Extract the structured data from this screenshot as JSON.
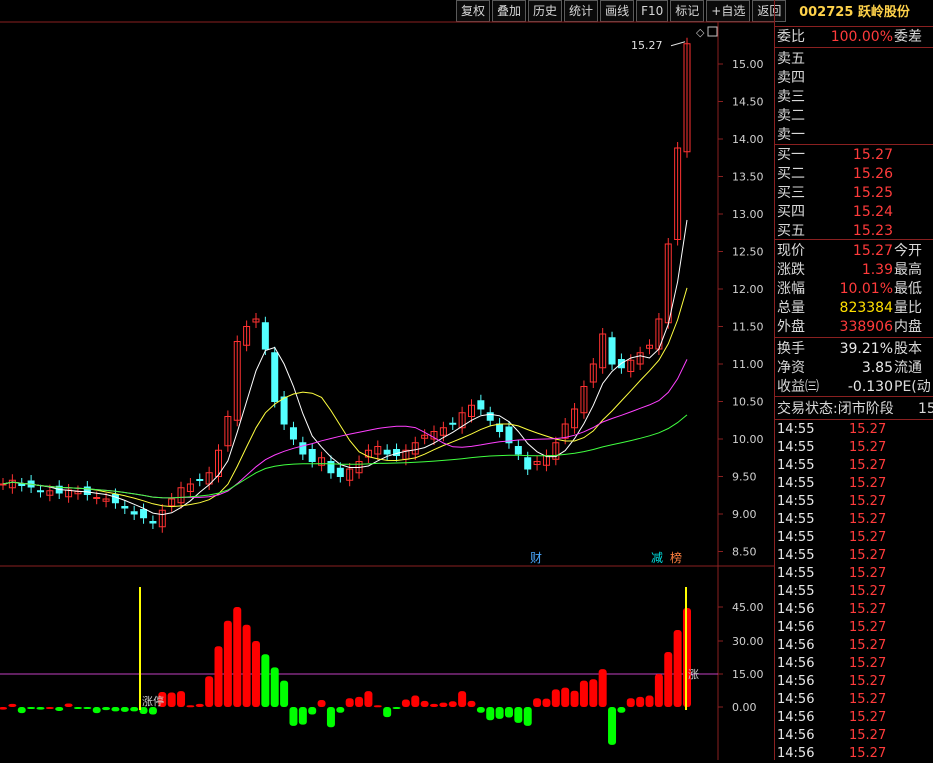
{
  "toolbar": {
    "buttons": [
      "复权",
      "叠加",
      "历史",
      "统计",
      "画线",
      "F10",
      "标记",
      "+自选",
      "返回"
    ]
  },
  "stock": {
    "code_name": "002725 跃岭股份"
  },
  "orderbook": {
    "ratio_label": "委比",
    "ratio_value": "100.00%",
    "diff_label": "委差",
    "asks": [
      {
        "label": "卖五",
        "price": ""
      },
      {
        "label": "卖四",
        "price": ""
      },
      {
        "label": "卖三",
        "price": ""
      },
      {
        "label": "卖二",
        "price": ""
      },
      {
        "label": "卖一",
        "price": ""
      }
    ],
    "bids": [
      {
        "label": "买一",
        "price": "15.27"
      },
      {
        "label": "买二",
        "price": "15.26"
      },
      {
        "label": "买三",
        "price": "15.25"
      },
      {
        "label": "买四",
        "price": "15.24"
      },
      {
        "label": "买五",
        "price": "15.23"
      }
    ]
  },
  "quote": [
    {
      "label": "现价",
      "value": "15.27",
      "sub": "今开"
    },
    {
      "label": "涨跌",
      "value": "1.39",
      "sub": "最高"
    },
    {
      "label": "涨幅",
      "value": "10.01%",
      "sub": "最低"
    },
    {
      "label": "总量",
      "value": "823384",
      "sub": "量比"
    },
    {
      "label": "外盘",
      "value": "338906",
      "sub": "内盘"
    }
  ],
  "fundamentals": [
    {
      "label": "换手",
      "value": "39.21%",
      "sub": "股本"
    },
    {
      "label": "净资",
      "value": "3.85",
      "sub": "流通"
    },
    {
      "label": "收益㈢",
      "value": "-0.130",
      "sub": "PE(动"
    }
  ],
  "trade_status": {
    "label": "交易状态:",
    "value": "闭市阶段",
    "extra": "15"
  },
  "ticks": [
    {
      "time": "14:55",
      "price": "15.27"
    },
    {
      "time": "14:55",
      "price": "15.27"
    },
    {
      "time": "14:55",
      "price": "15.27"
    },
    {
      "time": "14:55",
      "price": "15.27"
    },
    {
      "time": "14:55",
      "price": "15.27"
    },
    {
      "time": "14:55",
      "price": "15.27"
    },
    {
      "time": "14:55",
      "price": "15.27"
    },
    {
      "time": "14:55",
      "price": "15.27"
    },
    {
      "time": "14:55",
      "price": "15.27"
    },
    {
      "time": "14:55",
      "price": "15.27"
    },
    {
      "time": "14:56",
      "price": "15.27"
    },
    {
      "time": "14:56",
      "price": "15.27"
    },
    {
      "time": "14:56",
      "price": "15.27"
    },
    {
      "time": "14:56",
      "price": "15.27"
    },
    {
      "time": "14:56",
      "price": "15.27"
    },
    {
      "time": "14:56",
      "price": "15.27"
    },
    {
      "time": "14:56",
      "price": "15.27"
    },
    {
      "time": "14:56",
      "price": "15.27"
    },
    {
      "time": "14:56",
      "price": "15.27"
    }
  ],
  "price_axis": [
    "15.00",
    "14.50",
    "14.00",
    "13.50",
    "13.00",
    "12.50",
    "12.00",
    "11.50",
    "11.00",
    "10.50",
    "10.00",
    "9.50",
    "9.00",
    "8.50"
  ],
  "indicator_axis": [
    "45.00",
    "30.00",
    "15.00",
    "0.00"
  ],
  "annotations": {
    "high_label": "15.27",
    "cai": "财",
    "jian": "减",
    "bang": "榜",
    "zhangting": "涨停",
    "zhang": "涨"
  },
  "colors": {
    "up": "#ff3232",
    "down": "#54ffff",
    "ma5": "#ffffff",
    "ma10": "#ffff40",
    "ma20": "#ff40ff",
    "ma60": "#40ff40",
    "bar_up": "#ff0000",
    "bar_down": "#00ff00"
  }
}
